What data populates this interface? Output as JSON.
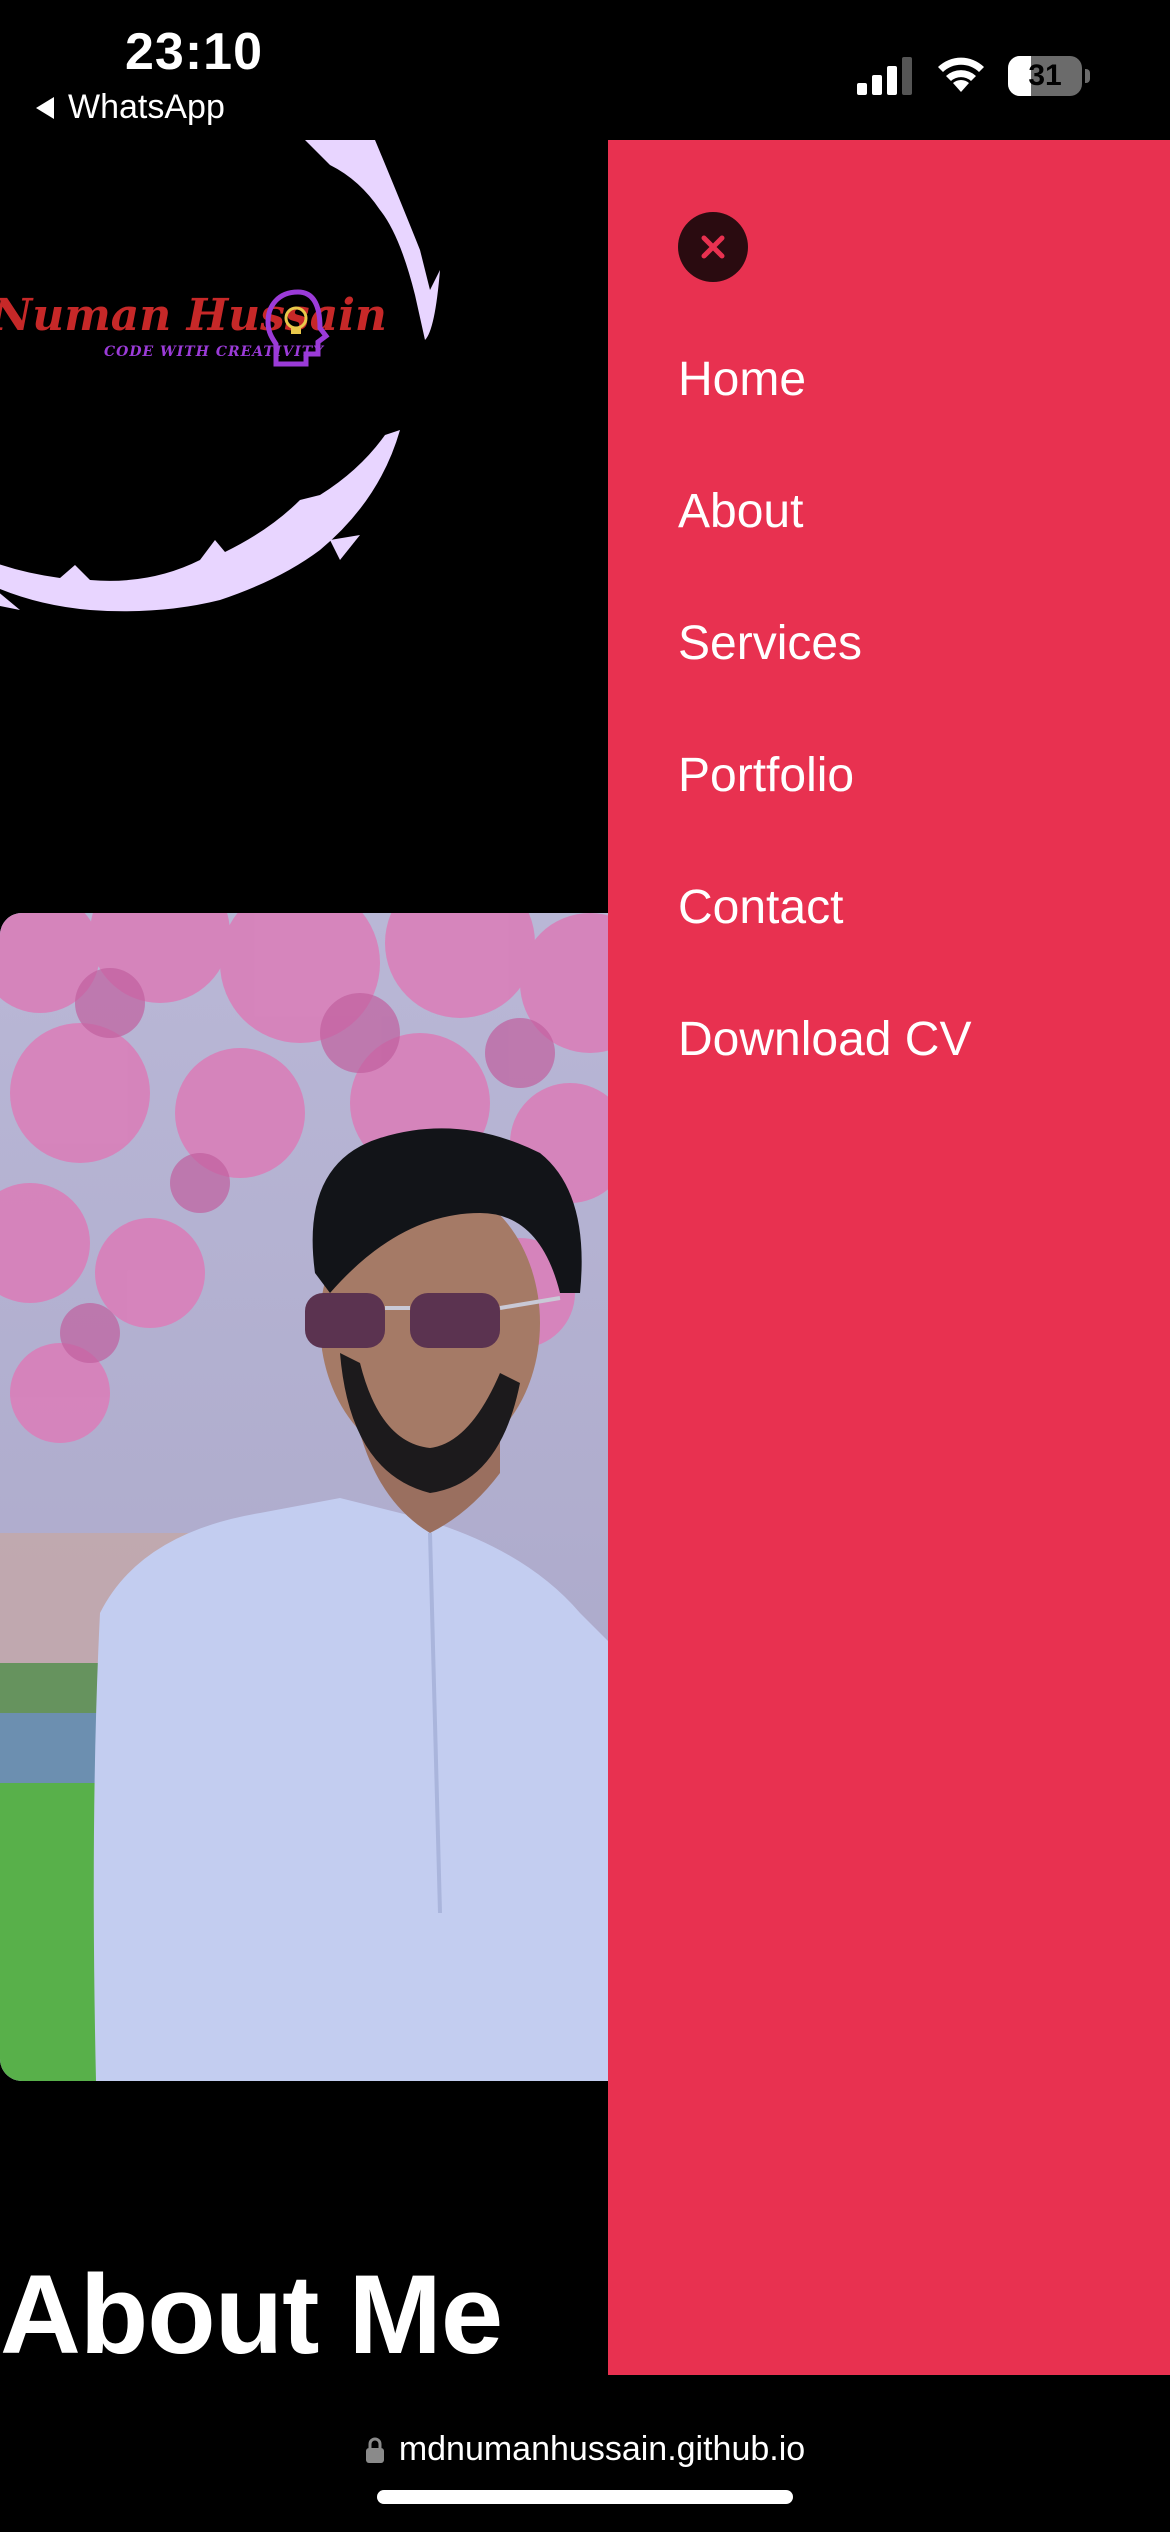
{
  "status_bar": {
    "time": "23:10",
    "back_label": "WhatsApp",
    "battery_level": "31",
    "battery_fraction": 0.31
  },
  "logo": {
    "name": "Numan Hussain",
    "tagline": "CODE WITH CREATIVITY",
    "ring_color": "#e8d5ff",
    "accent_red": "#c62828",
    "accent_purple": "#9b3bd8"
  },
  "page": {
    "about_heading": "About Me"
  },
  "menu": {
    "background": "#e83150",
    "close_icon": "close-icon",
    "items": [
      {
        "label": "Home"
      },
      {
        "label": "About"
      },
      {
        "label": "Services"
      },
      {
        "label": "Portfolio"
      },
      {
        "label": "Contact"
      },
      {
        "label": "Download CV"
      }
    ]
  },
  "browser": {
    "url": "mdnumanhussain.github.io",
    "lock_icon": "lock-icon"
  }
}
